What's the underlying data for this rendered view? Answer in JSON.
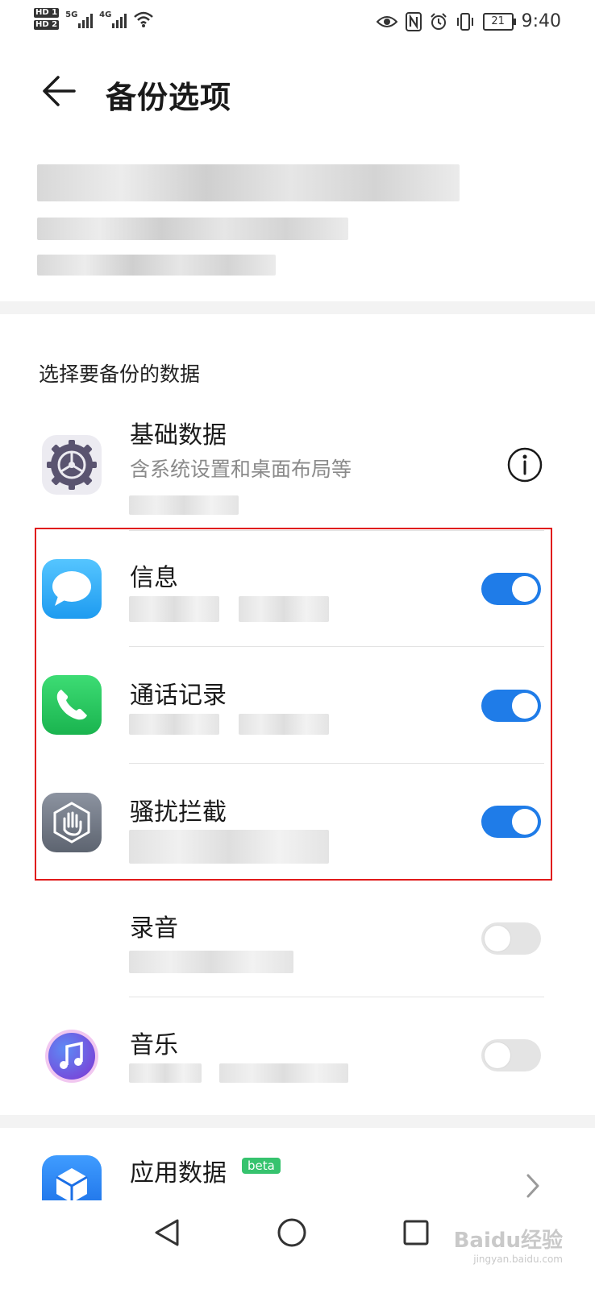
{
  "status_bar": {
    "hd1": "HD 1",
    "hd2": "HD 2",
    "sim1_network": "5G",
    "sim2_network": "4G",
    "battery": "21",
    "time": "9:40"
  },
  "header": {
    "title": "备份选项"
  },
  "section": {
    "label": "选择要备份的数据"
  },
  "items": [
    {
      "title": "基础数据",
      "subtitle": "含系统设置和桌面布局等",
      "icon": "settings-gear-icon",
      "accessory": "info-icon"
    },
    {
      "title": "信息",
      "icon": "message-icon",
      "toggle_on": true
    },
    {
      "title": "通话记录",
      "icon": "phone-icon",
      "toggle_on": true
    },
    {
      "title": "骚扰拦截",
      "icon": "block-hand-icon",
      "toggle_on": true
    },
    {
      "title": "录音",
      "icon": "recorder-wave-icon",
      "toggle_on": false
    },
    {
      "title": "音乐",
      "icon": "music-icon",
      "toggle_on": false
    },
    {
      "title": "应用数据",
      "badge": "beta",
      "icon": "app-cube-icon",
      "accessory": "chevron-right-icon"
    }
  ],
  "colors": {
    "accent": "#1f7ce8",
    "highlight_border": "#e01a1a",
    "beta_badge": "#36c36e"
  },
  "watermark": {
    "brand": "Baidu经验",
    "url": "jingyan.baidu.com"
  }
}
